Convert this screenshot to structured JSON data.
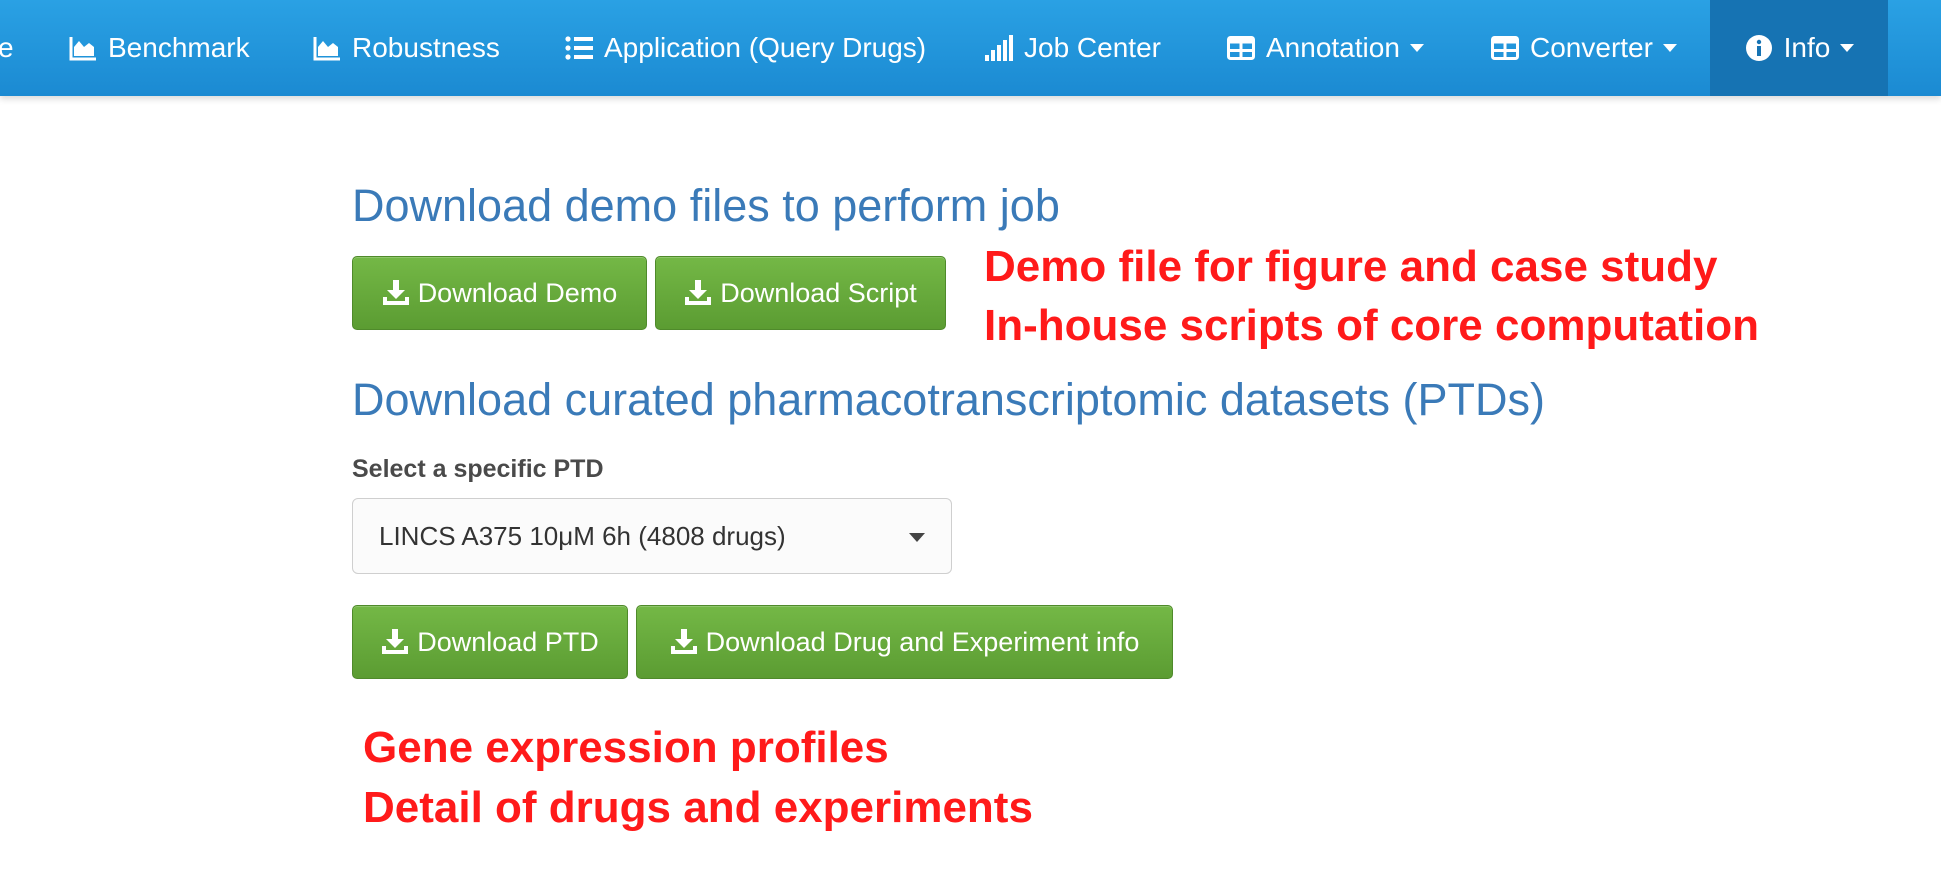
{
  "navbar": {
    "partial_item": "e",
    "items": [
      {
        "label": "Benchmark",
        "icon": "area-chart-icon",
        "dropdown": false
      },
      {
        "label": "Robustness",
        "icon": "area-chart-icon",
        "dropdown": false
      },
      {
        "label": "Application (Query Drugs)",
        "icon": "list-icon",
        "dropdown": false
      },
      {
        "label": "Job Center",
        "icon": "signal-bars-icon",
        "dropdown": false
      },
      {
        "label": "Annotation",
        "icon": "table-icon",
        "dropdown": true
      },
      {
        "label": "Converter",
        "icon": "table-icon",
        "dropdown": true
      },
      {
        "label": "Info",
        "icon": "info-circle-icon",
        "dropdown": true,
        "active": true
      }
    ]
  },
  "demo_section": {
    "title": "Download demo files to perform job",
    "download_demo_label": "Download Demo",
    "download_script_label": "Download Script"
  },
  "ptd_section": {
    "title": "Download curated pharmacotranscriptomic datasets (PTDs)",
    "select_label": "Select a specific PTD",
    "select_value": "LINCS A375 10μM 6h (4808 drugs)",
    "download_ptd_label": "Download PTD",
    "download_info_label": "Download Drug and Experiment info"
  },
  "annotations": {
    "demo_note_1": "Demo file for figure and case study",
    "demo_note_2": "In-house scripts of core computation",
    "ptd_note_1": "Gene expression profiles",
    "ptd_note_2": "Detail of drugs and experiments"
  },
  "colors": {
    "navbar": "#1f93d9",
    "active_nav": "#1673b3",
    "heading": "#3a7ab8",
    "button": "#67aa3c",
    "annotation": "#ff1a1a"
  }
}
